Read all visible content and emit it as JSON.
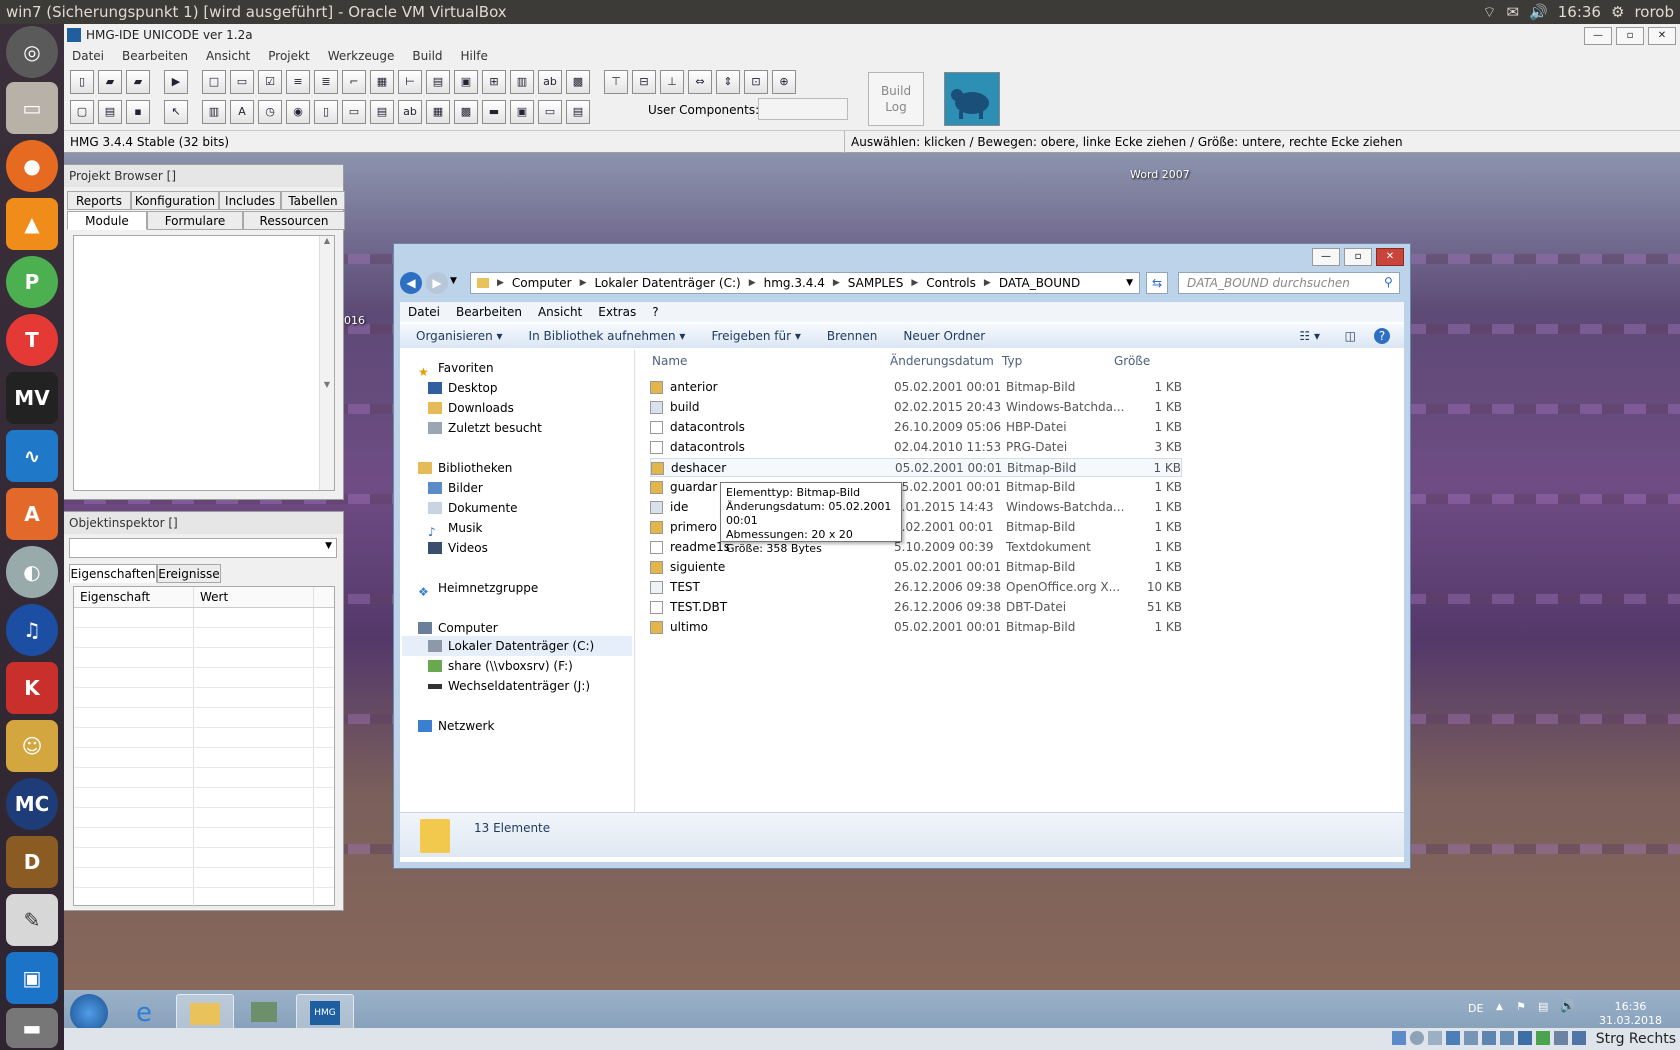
{
  "topbar": {
    "title": "win7 (Sicherungspunkt 1) [wird ausgeführt] - Oracle VM VirtualBox",
    "time": "16:36",
    "user": "rorob",
    "icons": [
      "wifi-icon",
      "mail-icon",
      "volume-icon",
      "gear-icon"
    ]
  },
  "launcher": {
    "items": [
      "dash-icon",
      "files-icon",
      "firefox-icon",
      "vlc-icon",
      "pdf-editor-icon",
      "text-editor-icon",
      "movie-maker-icon",
      "system-monitor-icon",
      "software-center-icon",
      "disk-tool-icon",
      "audacity-icon",
      "supertuxkart-icon",
      "game-icon",
      "media-center-icon",
      "dosbox-icon",
      "tools-icon",
      "virtualbox-icon",
      "drive-icon"
    ]
  },
  "hmg": {
    "title": "HMG-IDE  UNICODE  ver 1.2a",
    "menu": [
      "Datei",
      "Bearbeiten",
      "Ansicht",
      "Projekt",
      "Werkzeuge",
      "Build",
      "Hilfe"
    ],
    "user_components_label": "User Components:",
    "build_log_line1": "Build",
    "build_log_line2": "Log",
    "status_left": "HMG 3.4.4 Stable (32 bits)",
    "status_right": "Auswählen: klicken / Bewegen: obere, linke Ecke ziehen / Größe: untere, rechte Ecke ziehen"
  },
  "project_browser": {
    "title": "Projekt Browser []",
    "tabs_top": [
      "Reports",
      "Konfiguration",
      "Includes",
      "Tabellen"
    ],
    "tabs_bottom": [
      "Module",
      "Formulare",
      "Ressourcen"
    ]
  },
  "object_inspector": {
    "title": "Objektinspektor []",
    "tabs": [
      "Eigenschaften",
      "Ereignisse"
    ],
    "col_property": "Eigenschaft",
    "col_value": "Wert"
  },
  "explorer": {
    "breadcrumbs": [
      "Computer",
      "Lokaler Datenträger (C:)",
      "hmg.3.4.4",
      "SAMPLES",
      "Controls",
      "DATA_BOUND"
    ],
    "search_placeholder": "DATA_BOUND durchsuchen",
    "menu": [
      "Datei",
      "Bearbeiten",
      "Ansicht",
      "Extras",
      "?"
    ],
    "commands": [
      "Organisieren ▾",
      "In Bibliothek aufnehmen ▾",
      "Freigeben für ▾",
      "Brennen",
      "Neuer Ordner"
    ],
    "nav": [
      {
        "label": "Favoriten",
        "icon": "star-icon"
      },
      {
        "label": "Desktop",
        "icon": "desktop-icon"
      },
      {
        "label": "Downloads",
        "icon": "downloads-folder-icon"
      },
      {
        "label": "Zuletzt besucht",
        "icon": "recent-places-icon"
      },
      {
        "label": "Bibliotheken",
        "icon": "libraries-icon"
      },
      {
        "label": "Bilder",
        "icon": "pictures-icon"
      },
      {
        "label": "Dokumente",
        "icon": "documents-icon"
      },
      {
        "label": "Musik",
        "icon": "music-icon"
      },
      {
        "label": "Videos",
        "icon": "videos-icon"
      },
      {
        "label": "Heimnetzgruppe",
        "icon": "homegroup-icon"
      },
      {
        "label": "Computer",
        "icon": "computer-icon"
      },
      {
        "label": "Lokaler Datenträger (C:)",
        "icon": "hard-drive-icon"
      },
      {
        "label": "share (\\\\vboxsrv) (F:)",
        "icon": "network-drive-icon"
      },
      {
        "label": "Wechseldatenträger (J:)",
        "icon": "removable-drive-icon"
      },
      {
        "label": "Netzwerk",
        "icon": "network-icon"
      }
    ],
    "columns": [
      "Name",
      "Änderungsdatum",
      "Typ",
      "Größe"
    ],
    "files": [
      {
        "name": "anterior",
        "date": "05.02.2001 00:01",
        "type": "Bitmap-Bild",
        "size": "1 KB",
        "icon": "bitmap-file-icon"
      },
      {
        "name": "build",
        "date": "02.02.2015 20:43",
        "type": "Windows-Batchda...",
        "size": "1 KB",
        "icon": "batch-file-icon"
      },
      {
        "name": "datacontrols",
        "date": "26.10.2009 05:06",
        "type": "HBP-Datei",
        "size": "1 KB",
        "icon": "generic-file-icon"
      },
      {
        "name": "datacontrols",
        "date": "02.04.2010 11:53",
        "type": "PRG-Datei",
        "size": "3 KB",
        "icon": "generic-file-icon"
      },
      {
        "name": "deshacer",
        "date": "05.02.2001 00:01",
        "type": "Bitmap-Bild",
        "size": "1 KB",
        "icon": "bitmap-file-icon"
      },
      {
        "name": "guardar",
        "date": "05.02.2001 00:01",
        "type": "Bitmap-Bild",
        "size": "1 KB",
        "icon": "bitmap-file-icon"
      },
      {
        "name": "ide",
        "date": "0.01.2015 14:43",
        "type": "Windows-Batchda...",
        "size": "1 KB",
        "icon": "batch-file-icon"
      },
      {
        "name": "primero",
        "date": "5.02.2001 00:01",
        "type": "Bitmap-Bild",
        "size": "1 KB",
        "icon": "bitmap-file-icon"
      },
      {
        "name": "readme1s",
        "date": "5.10.2009 00:39",
        "type": "Textdokument",
        "size": "1 KB",
        "icon": "text-file-icon"
      },
      {
        "name": "siguiente",
        "date": "05.02.2001 00:01",
        "type": "Bitmap-Bild",
        "size": "1 KB",
        "icon": "bitmap-file-icon"
      },
      {
        "name": "TEST",
        "date": "26.12.2006 09:38",
        "type": "OpenOffice.org X...",
        "size": "10 KB",
        "icon": "spreadsheet-file-icon"
      },
      {
        "name": "TEST.DBT",
        "date": "26.12.2006 09:38",
        "type": "DBT-Datei",
        "size": "51 KB",
        "icon": "generic-file-icon"
      },
      {
        "name": "ultimo",
        "date": "05.02.2001 00:01",
        "type": "Bitmap-Bild",
        "size": "1 KB",
        "icon": "bitmap-file-icon"
      }
    ],
    "tooltip": {
      "line1": "Elementtyp: Bitmap-Bild",
      "line2": "Änderungsdatum: 05.02.2001 00:01",
      "line3": "Abmessungen: 20 x 20",
      "line4": "Größe: 358 Bytes"
    },
    "item_count": "13 Elemente"
  },
  "desktop_labels": {
    "word": "Word 2007",
    "partial": "016"
  },
  "taskbar": {
    "lang": "DE",
    "time": "16:36",
    "date": "31.03.2018",
    "hmg_button": "HMG"
  },
  "vbox_status": {
    "hostkey": "Strg Rechts"
  },
  "colors": {
    "ubuntu_panel": "#3c3b37",
    "win7_taskbar": "#8aa3bd",
    "explorer_frame": "#bcd3ea",
    "selection": "#cfe3f8"
  }
}
